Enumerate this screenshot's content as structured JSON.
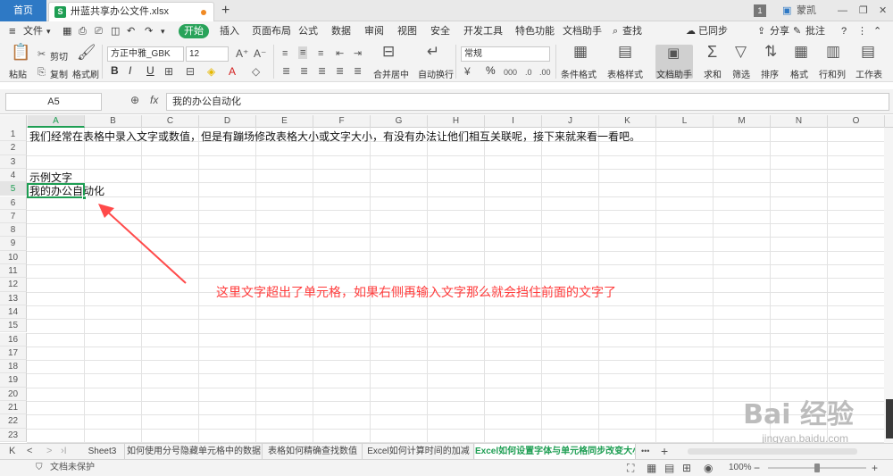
{
  "titlebar": {
    "home_tab": "首页",
    "doc_tab": "卅蓝共享办公文件.xlsx",
    "xl_icon_label": "S",
    "new_tab": "+",
    "badge": "1",
    "user": "蒙凯",
    "minimize": "—",
    "restore": "❐",
    "close": "✕"
  },
  "menubar": {
    "hamburger": "≡",
    "file": "文件",
    "start": "开始",
    "items": [
      "插入",
      "页面布局",
      "公式",
      "数据",
      "审阅",
      "视图",
      "安全",
      "开发工具",
      "特色功能",
      "文档助手"
    ],
    "search": "查找",
    "sync": "已同步",
    "share": "分享",
    "comment": "批注",
    "help": "?"
  },
  "ribbon": {
    "paste": "粘贴",
    "cut": "剪切",
    "copy": "复制",
    "format_painter": "格式刷",
    "font_name": "方正中雅_GBK",
    "font_size": "12",
    "bold": "B",
    "italic": "I",
    "underline": "U",
    "merge_center": "合并居中",
    "wrap_text": "自动换行",
    "number_format": "常规",
    "percent": "%",
    "conditional_format": "条件格式",
    "table_style": "表格样式",
    "doc_helper": "文档助手",
    "sum": "求和",
    "filter": "筛选",
    "sort": "排序",
    "format": "格式",
    "row_col": "行和列",
    "worksheet": "工作表"
  },
  "formula_bar": {
    "name_box": "A5",
    "fx": "fx",
    "content": "我的办公自动化"
  },
  "grid": {
    "columns": [
      "A",
      "B",
      "C",
      "D",
      "E",
      "F",
      "G",
      "H",
      "I",
      "J",
      "K",
      "L",
      "M",
      "N",
      "O"
    ],
    "rows": [
      "1",
      "2",
      "3",
      "4",
      "5",
      "6",
      "7",
      "8",
      "9",
      "10",
      "11",
      "12",
      "13",
      "14",
      "15",
      "16",
      "17",
      "18",
      "19",
      "20",
      "21",
      "22",
      "23"
    ],
    "cells": {
      "A1": "我们经常在表格中录入文字或数值，但是有蹦场修改表格大小或文字大小，有没有办法让他们相互关联呢，接下来就来看一看吧。",
      "A4": "示例文字",
      "A5": "我的办公自动化"
    },
    "annotation": "这里文字超出了单元格，如果右侧再输入文字那么就会挡住前面的文字了",
    "watermark": "Bai 经验",
    "watermark_url": "jingyan.baidu.com"
  },
  "sheet_tabs": [
    "Sheet3",
    "如何使用分号隐藏单元格中的数据",
    "表格如何精确查找数值",
    "Excel如何计算时间的加减",
    "Excel如何设置字体与单元格同步改变大小"
  ],
  "sheet_nav": {
    "first": "K",
    "prev": "<",
    "next": ">",
    "last": "›I",
    "more": "•••",
    "add": "+"
  },
  "statusbar": {
    "protect": "文档未保护",
    "zoom": "100%",
    "zoom_minus": "−",
    "zoom_plus": "+"
  },
  "colors": {
    "accent_green": "#1e9e53",
    "annotation_red": "#ff3b3b",
    "home_blue": "#2e79c5"
  }
}
